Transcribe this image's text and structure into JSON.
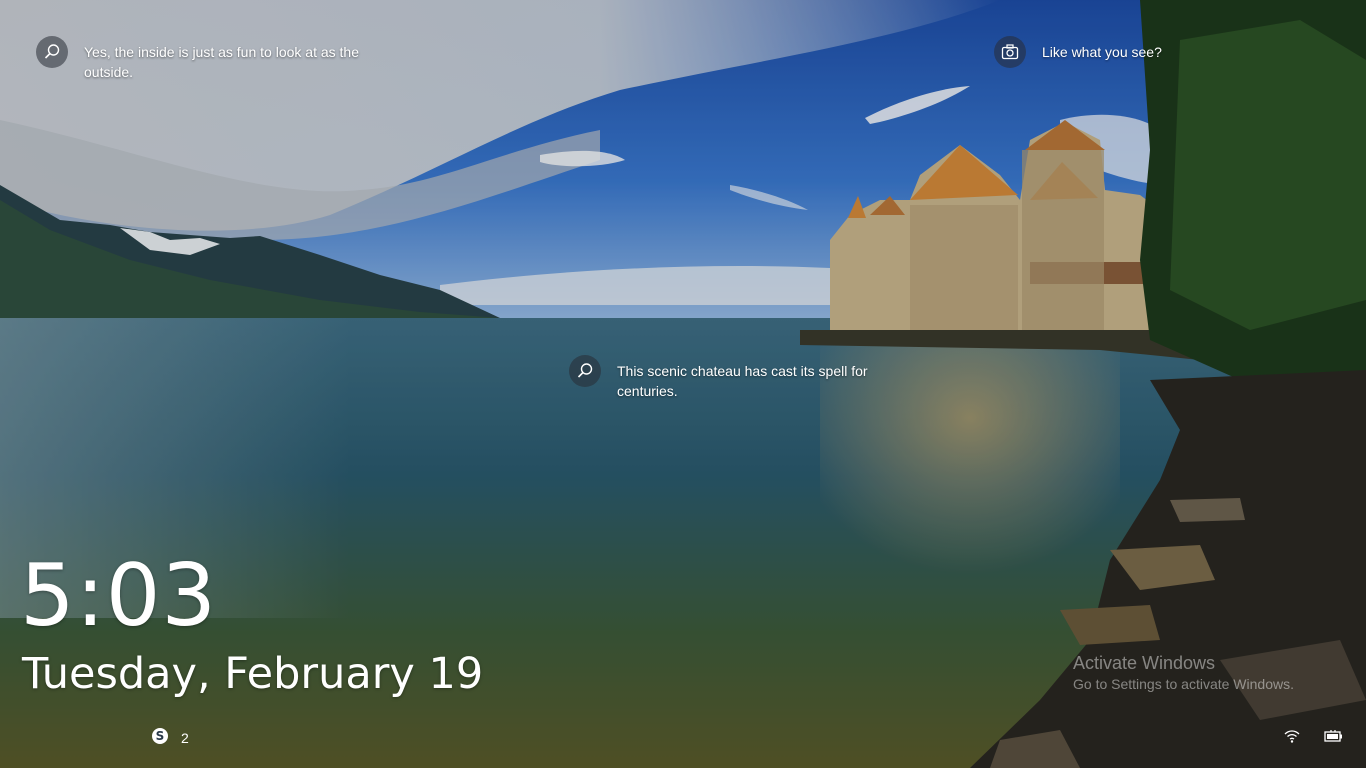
{
  "hotspots": [
    {
      "text": "Yes, the inside is just as fun to look at as the outside.",
      "icon": "search-icon"
    },
    {
      "text": "This scenic chateau has cast its spell for centuries.",
      "icon": "search-icon"
    }
  ],
  "like": {
    "text": "Like what you see?",
    "icon": "camera-icon"
  },
  "time": "5:03",
  "date": "Tuesday, February 19",
  "notifications": [
    {
      "app": "skype-icon",
      "count": "2"
    }
  ],
  "watermark": {
    "title": "Activate Windows",
    "subtitle": "Go to Settings to activate Windows."
  },
  "tray": {
    "icons": [
      "network-icon",
      "battery-icon"
    ]
  }
}
